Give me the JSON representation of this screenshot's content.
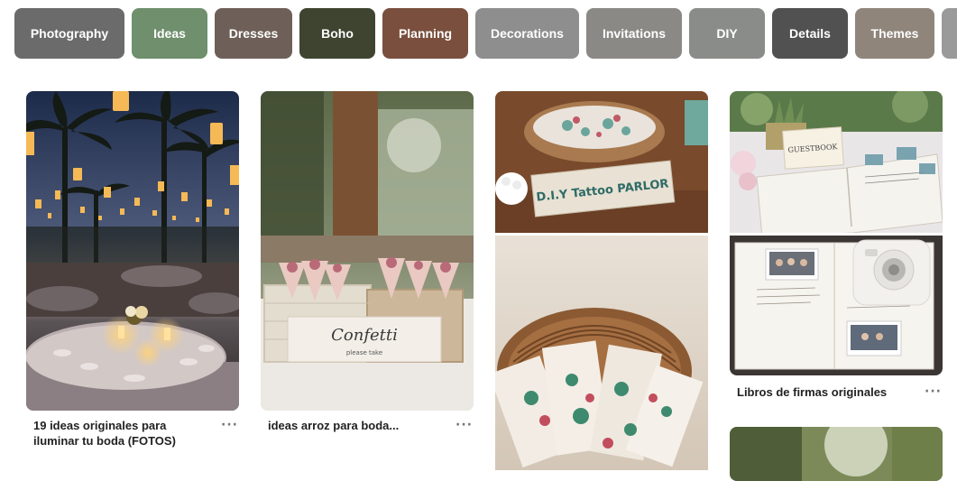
{
  "categories": [
    {
      "label": "Photography",
      "color": "#6b6b6b"
    },
    {
      "label": "Ideas",
      "color": "#6f8f6d"
    },
    {
      "label": "Dresses",
      "color": "#6e6058"
    },
    {
      "label": "Boho",
      "color": "#3e4430"
    },
    {
      "label": "Planning",
      "color": "#7a4f3e"
    },
    {
      "label": "Decorations",
      "color": "#8e8e8e"
    },
    {
      "label": "Invitations",
      "color": "#8b8985"
    },
    {
      "label": "DIY",
      "color": "#8a8c89"
    },
    {
      "label": "Details",
      "color": "#505150"
    },
    {
      "label": "Themes",
      "color": "#8f857b"
    }
  ],
  "pins": [
    {
      "title": "19 ideas originales para iluminar tu boda (FOTOS)",
      "more": "···"
    },
    {
      "title": "ideas arroz para boda...",
      "more": "···"
    },
    {
      "title": "",
      "more": ""
    },
    {
      "title": "Libros de firmas originales",
      "more": "···"
    }
  ],
  "images": {
    "confetti_sign": "Confetti",
    "confetti_sub": "please take",
    "tattoo_sign": "D.I.Y Tattoo PARLOR",
    "guestbook_sign": "GUESTBOOK"
  }
}
